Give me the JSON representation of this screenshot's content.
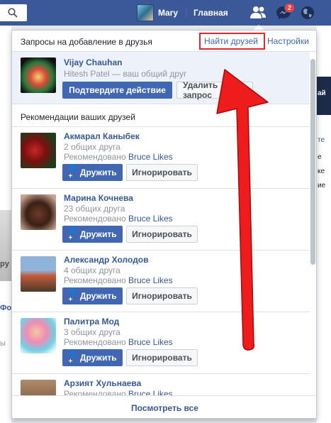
{
  "topbar": {
    "user_name": "Mary",
    "home_label": "Главная",
    "messages_badge": "2",
    "icons": [
      "search-icon",
      "friends-icon",
      "messenger-icon",
      "globe-icon"
    ]
  },
  "background": {
    "left_texts": [
      "py",
      "Фо",
      "ы"
    ],
    "right_texts": [
      "ай",
      "те",
      "е",
      "ке",
      "ие"
    ]
  },
  "dropdown": {
    "title": "Запросы на добавление в друзья",
    "find_friends": "Найти друзей",
    "settings": "Настройки",
    "request": {
      "name": "Vijay Chauhan",
      "mutual_person": "Hitesh Patel",
      "mutual_suffix": " — ваш общий друг",
      "confirm_label": "Подтвердите действие",
      "delete_label": "Удалить запрос"
    },
    "suggestions_title": "Рекомендации ваших друзей",
    "suggestions": [
      {
        "name": "Акмарал Каныбек",
        "mutual": "2 общих друга",
        "recommended_prefix": "Рекомендовано ",
        "recommended_by": "Bruce Likes"
      },
      {
        "name": "Марина Кочнева",
        "mutual": "23 общих друга",
        "recommended_prefix": "Рекомендовано ",
        "recommended_by": "Bruce Likes"
      },
      {
        "name": "Александр Холодов",
        "mutual": "4 общих друга",
        "recommended_prefix": "Рекомендовано ",
        "recommended_by": "Bruce Likes"
      },
      {
        "name": "Палитра Мод",
        "mutual": "3 общих друга",
        "recommended_prefix": "Рекомендовано ",
        "recommended_by": "Bruce Likes"
      },
      {
        "name": "Арзият Хульнаева",
        "mutual": "",
        "recommended_prefix": "Рекомендовано ",
        "recommended_by": "Bruce Likes"
      }
    ],
    "add_friend_label": "Дружить",
    "ignore_label": "Игнорировать",
    "see_all": "Посмотреть все"
  },
  "colors": {
    "brand_blue": "#3b5998",
    "button_blue": "#4267b2",
    "link_blue": "#365899",
    "annotation_red": "#e4262a",
    "badge_red": "#fa3e3e"
  }
}
